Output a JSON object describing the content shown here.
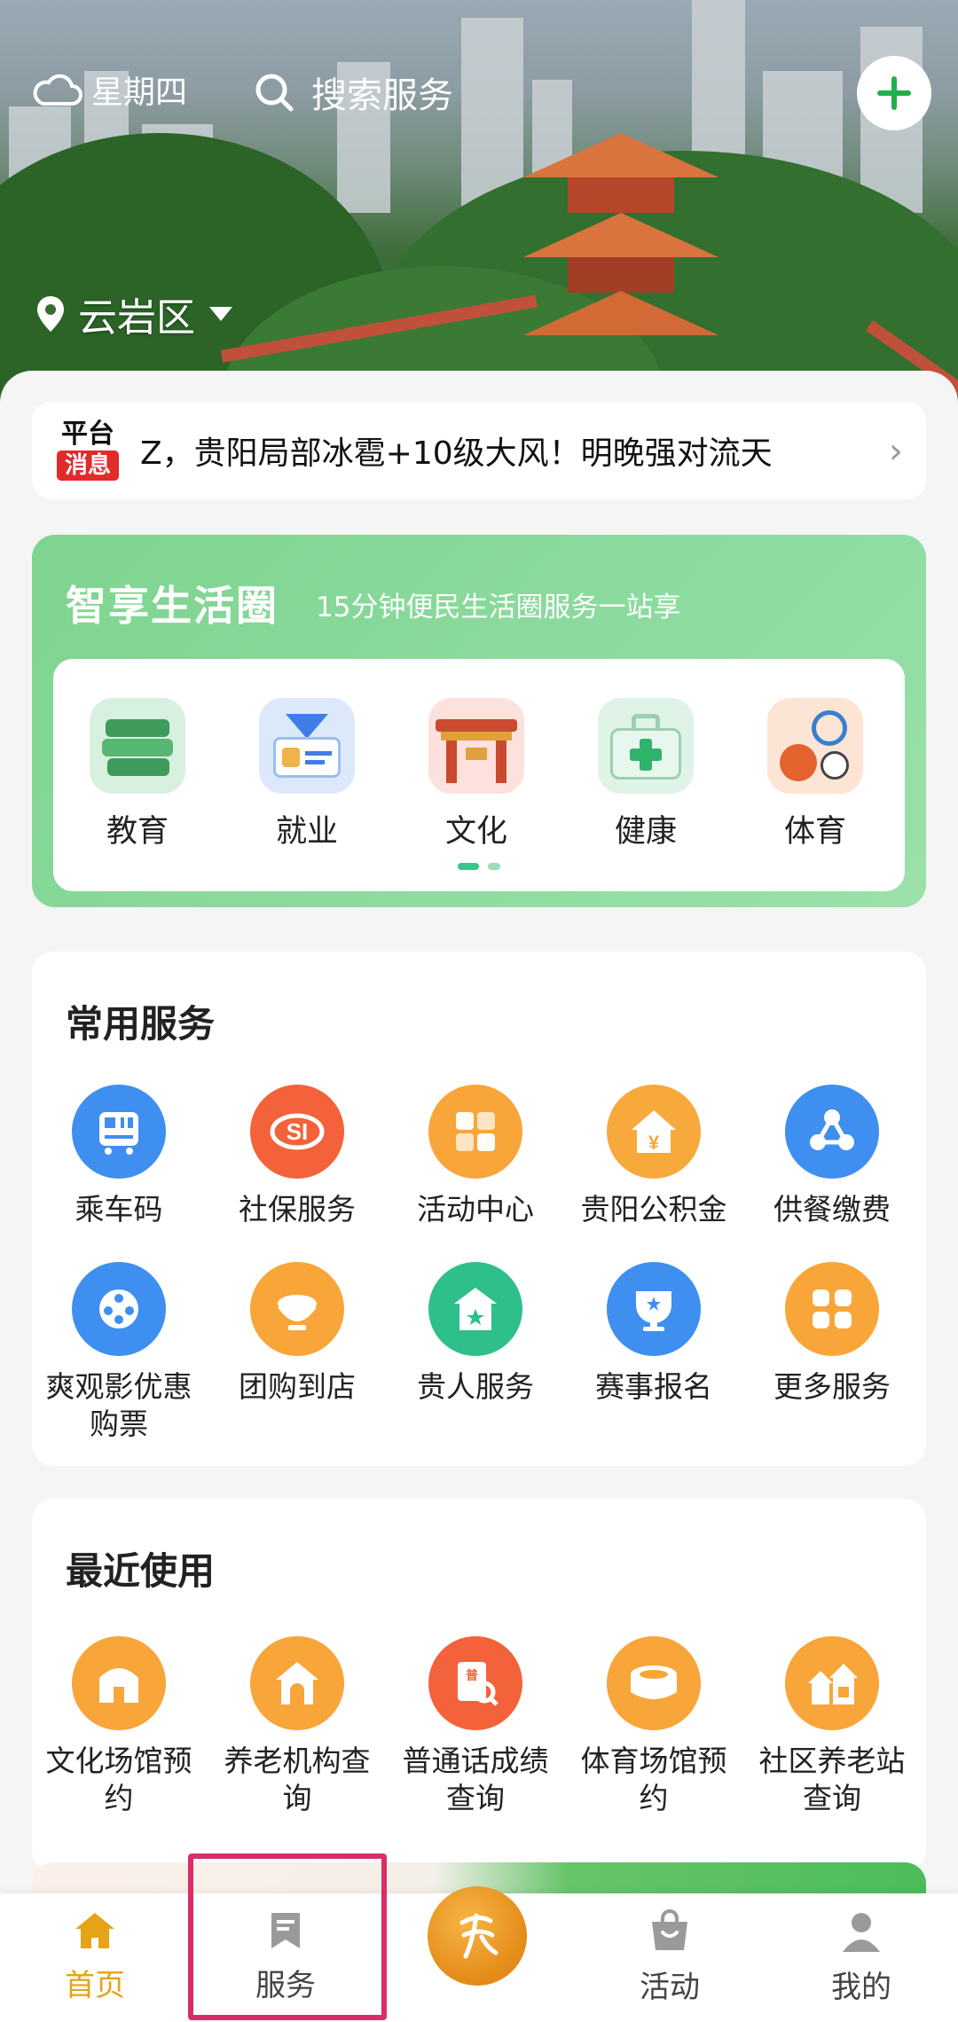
{
  "header": {
    "weather_label": "星期四",
    "search_placeholder": "搜索服务",
    "location": "云岩区"
  },
  "notice": {
    "badge_top": "平台",
    "badge_bottom": "消息",
    "text": "Z，贵阳局部冰雹+10级大风！明晚强对流天"
  },
  "smart_circle": {
    "title": "智享生活圈",
    "subtitle": "15分钟便民生活圈服务一站享",
    "items": [
      {
        "label": "教育",
        "icon": "books-icon"
      },
      {
        "label": "就业",
        "icon": "id-card-icon"
      },
      {
        "label": "文化",
        "icon": "gate-icon"
      },
      {
        "label": "健康",
        "icon": "medical-kit-icon"
      },
      {
        "label": "体育",
        "icon": "balls-icon"
      }
    ],
    "page_count": 2,
    "active_page": 1
  },
  "common_services": {
    "title": "常用服务",
    "items": [
      {
        "label": "乘车码",
        "icon": "bus-code-icon",
        "color": "#3e8ff0"
      },
      {
        "label": "社保服务",
        "icon": "social-security-icon",
        "color": "#f3623a"
      },
      {
        "label": "活动中心",
        "icon": "puzzle-icon",
        "color": "#f8a53a"
      },
      {
        "label": "贵阳公积金",
        "icon": "house-yuan-icon",
        "color": "#f7a93c"
      },
      {
        "label": "供餐缴费",
        "icon": "meal-icon",
        "color": "#3e8ff0"
      },
      {
        "label": "爽观影优惠购票",
        "icon": "film-reel-icon",
        "color": "#3e8ff0"
      },
      {
        "label": "团购到店",
        "icon": "bowl-icon",
        "color": "#f8a53a"
      },
      {
        "label": "贵人服务",
        "icon": "star-house-icon",
        "color": "#2fbf8a"
      },
      {
        "label": "赛事报名",
        "icon": "trophy-icon",
        "color": "#3e8ff0"
      },
      {
        "label": "更多服务",
        "icon": "grid-icon",
        "color": "#f8a53a"
      }
    ]
  },
  "recent": {
    "title": "最近使用",
    "items": [
      {
        "label": "文化场馆预约",
        "icon": "venue-icon",
        "color": "#f8a53a"
      },
      {
        "label": "养老机构查询",
        "icon": "elder-home-icon",
        "color": "#f8a53a"
      },
      {
        "label": "普通话成绩查询",
        "icon": "score-search-icon",
        "color": "#f3623a"
      },
      {
        "label": "体育场馆预约",
        "icon": "stadium-icon",
        "color": "#f8a53a"
      },
      {
        "label": "社区养老站查询",
        "icon": "community-icon",
        "color": "#f8a53a"
      }
    ]
  },
  "tabbar": {
    "home": "首页",
    "services": "服务",
    "activity": "活动",
    "mine": "我的",
    "active": "home",
    "accent": "#e7a318"
  }
}
